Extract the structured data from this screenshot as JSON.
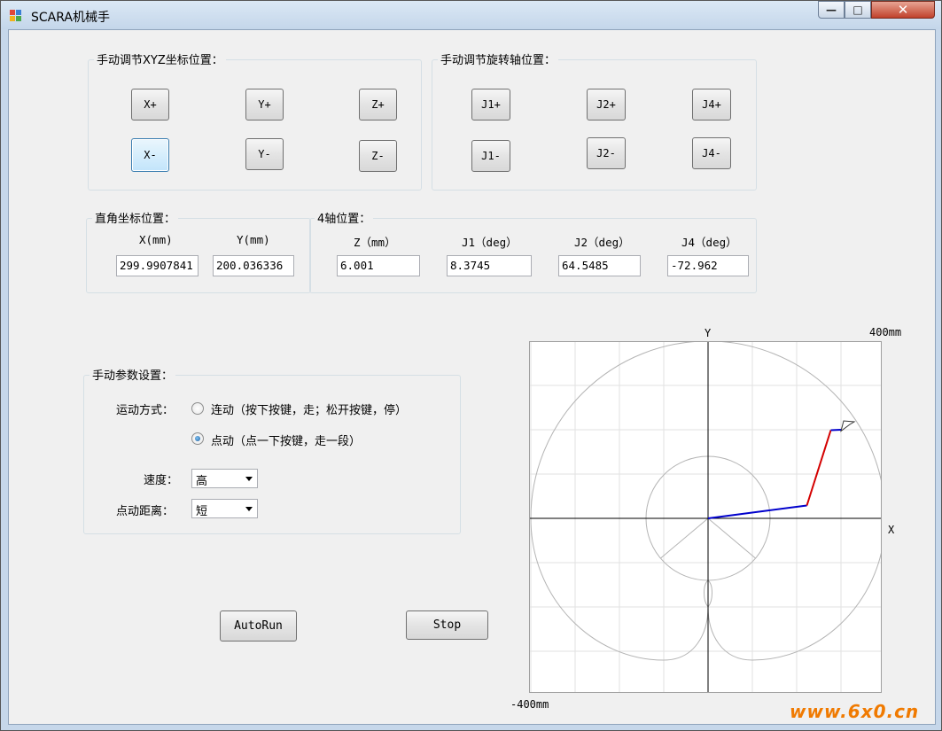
{
  "window": {
    "title": "SCARA机械手",
    "controls": {
      "minimize": "—",
      "maximize": "□",
      "close": "✕"
    }
  },
  "xyz_group": {
    "title": "手动调节XYZ坐标位置：",
    "buttons": [
      "X+",
      "Y+",
      "Z+",
      "X-",
      "Y-",
      "Z-"
    ]
  },
  "joint_group": {
    "title": "手动调节旋转轴位置：",
    "buttons": [
      "J1+",
      "J2+",
      "J4+",
      "J1-",
      "J2-",
      "J4-"
    ]
  },
  "cartesian": {
    "title": "直角坐标位置：",
    "x_label": "X(mm)",
    "y_label": "Y(mm)",
    "x_value": "299.9907841",
    "y_value": "200.036336"
  },
  "axis4": {
    "title": "4轴位置：",
    "z_label": "Z（mm）",
    "j1_label": "J1（deg）",
    "j2_label": "J2（deg）",
    "j4_label": "J4（deg）",
    "z_value": "6.001",
    "j1_value": "8.3745",
    "j2_value": "64.5485",
    "j4_value": "-72.962"
  },
  "params": {
    "title": "手动参数设置：",
    "motion_label": "运动方式：",
    "option_continuous": "连动（按下按键，走；松开按键，停）",
    "option_step": "点动（点一下按键，走一段）",
    "selected_option": "option_step",
    "speed_label": "速度：",
    "speed_value": "高",
    "step_label": "点动距离：",
    "step_value": "短"
  },
  "actions": {
    "autorun": "AutoRun",
    "stop": "Stop"
  },
  "plot": {
    "y_axis_label": "Y",
    "x_axis_label": "X",
    "max_label": "400mm",
    "min_label": "-400mm",
    "range_mm": [
      -400,
      400
    ],
    "link1_color": "#0000cc",
    "link2_color": "#d40000",
    "link3_color": "#0000cc",
    "origin_mm": [
      0,
      0
    ],
    "joint2_mm": [
      223,
      29
    ],
    "joint3_mm": [
      277,
      199
    ],
    "tool_mm": [
      300,
      200
    ]
  },
  "watermark": "www.6x0.cn"
}
